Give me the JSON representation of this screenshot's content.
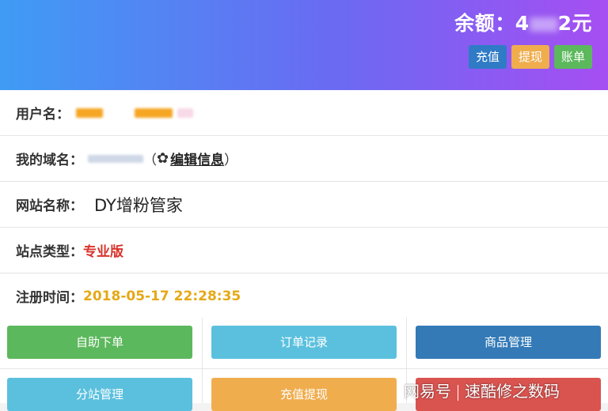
{
  "header": {
    "balance_prefix": "余额：4",
    "balance_suffix": "2元",
    "buttons": {
      "recharge": "充值",
      "withdraw": "提现",
      "bill": "账单"
    }
  },
  "info": {
    "username_label": "用户名：",
    "domain_label": "我的域名：",
    "domain_open": "（",
    "edit_link": "编辑信息",
    "domain_close": "）",
    "site_name_label": "网站名称：",
    "site_name": "DY增粉管家",
    "site_type_label": "站点类型：",
    "site_type": "专业版",
    "reg_time_label": "注册时间：",
    "reg_time": "2018-05-17 22:28:35"
  },
  "actions": {
    "self_order": "自助下单",
    "order_records": "订单记录",
    "product_mgmt": "商品管理",
    "substation_mgmt": "分站管理",
    "recharge_withdraw": "充值提现",
    "c6": ""
  },
  "watermark": {
    "left": "网易号",
    "right": "速酷修之数码"
  },
  "colors": {
    "header_gradient_start": "#3f9cf4",
    "header_gradient_end": "#a64ef2",
    "green": "#5cb85c",
    "info": "#5bc0de",
    "primary": "#337ab7",
    "warning": "#f0ad4e",
    "danger": "#d9534f",
    "site_type": "#d9332b",
    "reg_time": "#e6a817"
  }
}
